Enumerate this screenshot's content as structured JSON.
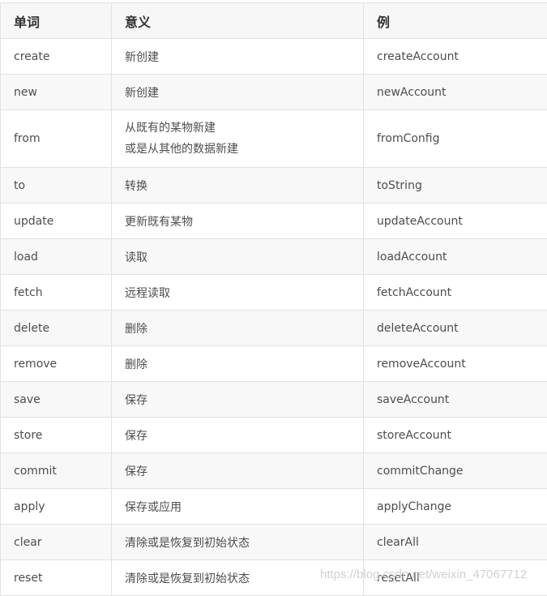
{
  "table": {
    "headers": [
      "单词",
      "意义",
      "例"
    ],
    "rows": [
      {
        "word": "create",
        "meaning": [
          "新创建"
        ],
        "example": "createAccount"
      },
      {
        "word": "new",
        "meaning": [
          "新创建"
        ],
        "example": "newAccount"
      },
      {
        "word": "from",
        "meaning": [
          "从既有的某物新建",
          "或是从其他的数据新建"
        ],
        "example": "fromConfig"
      },
      {
        "word": "to",
        "meaning": [
          "转换"
        ],
        "example": "toString"
      },
      {
        "word": "update",
        "meaning": [
          "更新既有某物"
        ],
        "example": "updateAccount"
      },
      {
        "word": "load",
        "meaning": [
          "读取"
        ],
        "example": "loadAccount"
      },
      {
        "word": "fetch",
        "meaning": [
          "远程读取"
        ],
        "example": "fetchAccount"
      },
      {
        "word": "delete",
        "meaning": [
          "删除"
        ],
        "example": "deleteAccount"
      },
      {
        "word": "remove",
        "meaning": [
          "删除"
        ],
        "example": "removeAccount"
      },
      {
        "word": "save",
        "meaning": [
          "保存"
        ],
        "example": "saveAccount"
      },
      {
        "word": "store",
        "meaning": [
          "保存"
        ],
        "example": "storeAccount"
      },
      {
        "word": "commit",
        "meaning": [
          "保存"
        ],
        "example": "commitChange"
      },
      {
        "word": "apply",
        "meaning": [
          "保存或应用"
        ],
        "example": "applyChange"
      },
      {
        "word": "clear",
        "meaning": [
          "清除或是恢复到初始状态"
        ],
        "example": "clearAll"
      },
      {
        "word": "reset",
        "meaning": [
          "清除或是恢复到初始状态"
        ],
        "example": "resetAll"
      }
    ]
  },
  "watermark": "https://blog.csdn.net/weixin_47067712"
}
